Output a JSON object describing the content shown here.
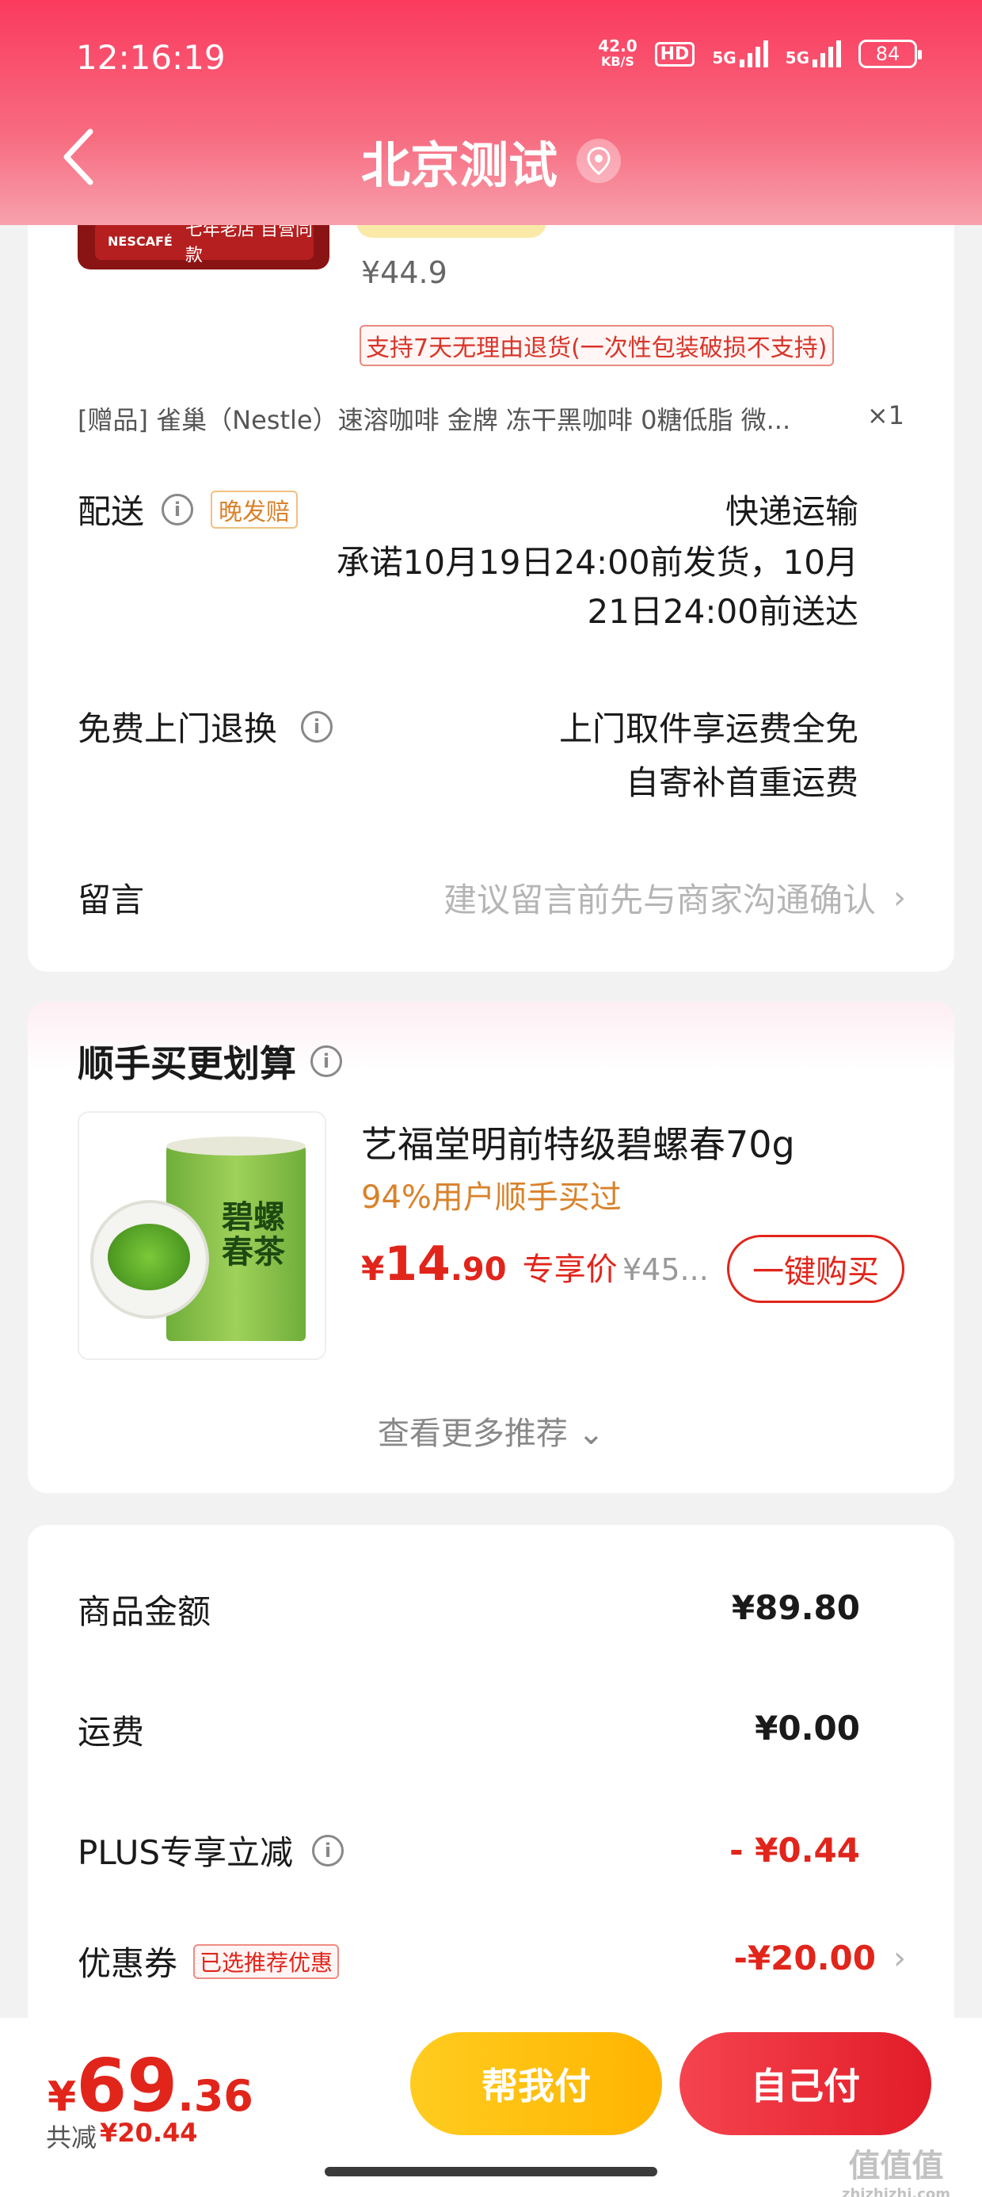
{
  "status_bar": {
    "time": "12:16:19",
    "net_speed_value": "42.0",
    "net_speed_unit": "KB/S",
    "hd_label": "HD",
    "sig1_label": "5G",
    "sig2_label": "5G",
    "battery": "84"
  },
  "header": {
    "title": "北京测试",
    "back_icon": "chevron-left-icon",
    "location_icon": "location-pin-icon"
  },
  "product": {
    "brand_text": "NESCAFÉ",
    "image_label": "七年老店 自营同款",
    "price": "¥44.9",
    "return_tag": "支持7天无理由退货(一次性包装破损不支持)",
    "gift_text": "[赠品]  雀巢（Nestle）速溶咖啡 金牌 冻干黑咖啡 0糖低脂 微...",
    "gift_qty": "×1"
  },
  "delivery": {
    "label": "配送",
    "late_tag": "晚发赔",
    "method": "快递运输",
    "promise_line1": "承诺10月19日24:00前发货，10月",
    "promise_line2": "21日24:00前送达"
  },
  "return_service": {
    "label": "免费上门退换",
    "line1": "上门取件享运费全免",
    "line2": "自寄补首重运费"
  },
  "message": {
    "label": "留言",
    "placeholder": "建议留言前先与商家沟通确认",
    "chevron": "›"
  },
  "recommend": {
    "title": "顺手买更划算",
    "image_text": "碧螺春茶",
    "name": "艺福堂明前特级碧螺春70g",
    "subtitle": "94%用户顺手买过",
    "price_symbol": "¥",
    "price_int": "14",
    "price_dec": ".90",
    "price_label": "专享价",
    "orig_price": "¥45...",
    "buy_button": "一键购买",
    "see_more": "查看更多推荐 ⌄"
  },
  "summary": {
    "rows": [
      {
        "label": "商品金额",
        "value": "¥89.80"
      },
      {
        "label": "运费",
        "value": "¥0.00"
      },
      {
        "label": "PLUS专享立减",
        "value": "- ¥0.44"
      },
      {
        "label": "优惠券",
        "tag": "已选推荐优惠",
        "value": "-¥20.00"
      }
    ]
  },
  "bottom": {
    "total_symbol": "¥",
    "total_int": "69",
    "total_dec": ".36",
    "saved_label": "共减",
    "saved_value": "¥20.44",
    "help_pay": "帮我付",
    "self_pay": "自己付"
  },
  "watermark": {
    "main": "值值值",
    "sub": "zhizhizhi.com"
  },
  "colors": {
    "brand_red": "#e1251b",
    "header_pink": "#fb3a5e",
    "accent_orange": "#d9822b",
    "help_yellow": "#ffc107"
  }
}
